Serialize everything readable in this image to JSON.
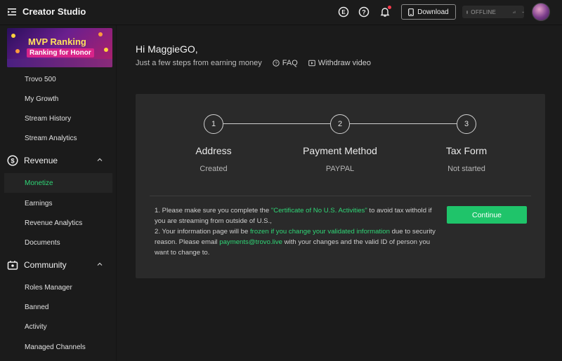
{
  "app": {
    "title": "Creator Studio"
  },
  "topbar": {
    "download_label": "Download",
    "status_label": "OFFLINE"
  },
  "sidebar": {
    "banner": {
      "line1": "MVP Ranking",
      "line2": "Ranking for Honor"
    },
    "items_top": [
      "Trovo 500",
      "My Growth",
      "Stream History",
      "Stream Analytics"
    ],
    "revenue": {
      "label": "Revenue",
      "items": [
        "Monetize",
        "Earnings",
        "Revenue Analytics",
        "Documents"
      ]
    },
    "community": {
      "label": "Community",
      "items": [
        "Roles Manager",
        "Banned",
        "Activity",
        "Managed Channels"
      ]
    }
  },
  "main": {
    "greeting": "Hi MaggieGO,",
    "subtitle": "Just a few steps from earning money",
    "faq_label": "FAQ",
    "withdraw_label": "Withdraw video",
    "steps": [
      {
        "number": "1",
        "title": "Address",
        "status": "Created"
      },
      {
        "number": "2",
        "title": "Payment Method",
        "status": "PAYPAL"
      },
      {
        "number": "3",
        "title": "Tax Form",
        "status": "Not started"
      }
    ],
    "notes": {
      "n1_a": "1. Please make sure you complete the ",
      "n1_link": "\"Certificate of No U.S. Activities\"",
      "n1_b": " to avoid tax withold if you are streaming from outside of U.S.,",
      "n2_a": "2. Your information page will be ",
      "n2_link": "frozen if you change your validated information",
      "n2_b": " due to security reason. Please email ",
      "n2_email": "payments@trovo.live",
      "n2_c": " with your changes and the valid ID of person you want to change to."
    },
    "continue_label": "Continue"
  },
  "colors": {
    "accent": "#2fd676",
    "button": "#1fc46a",
    "notification_dot": "#ff3b4e"
  }
}
